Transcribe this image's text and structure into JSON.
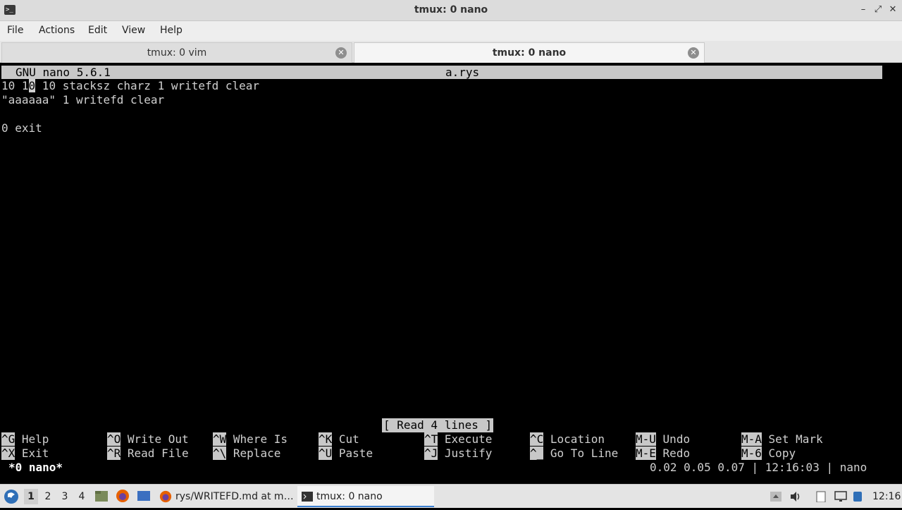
{
  "window": {
    "title": "tmux: 0 nano",
    "app_icon": ">_",
    "controls": {
      "minimize": "–",
      "maximize": "⤢",
      "close": "✕"
    }
  },
  "menubar": {
    "items": [
      "File",
      "Actions",
      "Edit",
      "View",
      "Help"
    ]
  },
  "tabs": [
    {
      "label": "tmux: 0 vim",
      "active": false
    },
    {
      "label": "tmux: 0 nano",
      "active": true
    }
  ],
  "nano": {
    "version": "GNU nano 5.6.1",
    "filename": "a.rys",
    "lines": [
      {
        "pre": "10 1",
        "cursor": "0",
        "post": " 10 stacksz charz 1 writefd clear"
      },
      {
        "text": "\"aaaaaa\" 1 writefd clear"
      },
      {
        "text": ""
      },
      {
        "text": "0 exit"
      }
    ],
    "status": "[ Read 4 lines ]",
    "shortcuts_row1": [
      {
        "key": "^G",
        "label": "Help"
      },
      {
        "key": "^O",
        "label": "Write Out"
      },
      {
        "key": "^W",
        "label": "Where Is"
      },
      {
        "key": "^K",
        "label": "Cut"
      },
      {
        "key": "^T",
        "label": "Execute"
      },
      {
        "key": "^C",
        "label": "Location"
      },
      {
        "key": "M-U",
        "label": "Undo"
      },
      {
        "key": "M-A",
        "label": "Set Mark"
      }
    ],
    "shortcuts_row2": [
      {
        "key": "^X",
        "label": "Exit"
      },
      {
        "key": "^R",
        "label": "Read File"
      },
      {
        "key": "^\\",
        "label": "Replace"
      },
      {
        "key": "^U",
        "label": "Paste"
      },
      {
        "key": "^J",
        "label": "Justify"
      },
      {
        "key": "^_",
        "label": "Go To Line"
      },
      {
        "key": "M-E",
        "label": "Redo"
      },
      {
        "key": "M-6",
        "label": "Copy"
      }
    ]
  },
  "tmux": {
    "window_label": "*0 nano*",
    "status_right": "0.02 0.05 0.07 | 12:16:03 | nano"
  },
  "taskbar": {
    "workspaces": [
      "1",
      "2",
      "3",
      "4"
    ],
    "active_workspace": "1",
    "tasks": [
      {
        "label": "rys/WRITEFD.md at m…",
        "icon": "firefox-icon"
      },
      {
        "label": "tmux: 0 nano",
        "icon": "terminal-icon"
      }
    ],
    "clock": "12:16"
  },
  "colors": {
    "terminal_bg": "#000000",
    "terminal_fg": "#d0d0d0",
    "inverse_bg": "#c8c8c8",
    "accent": "#3b7fd0"
  }
}
